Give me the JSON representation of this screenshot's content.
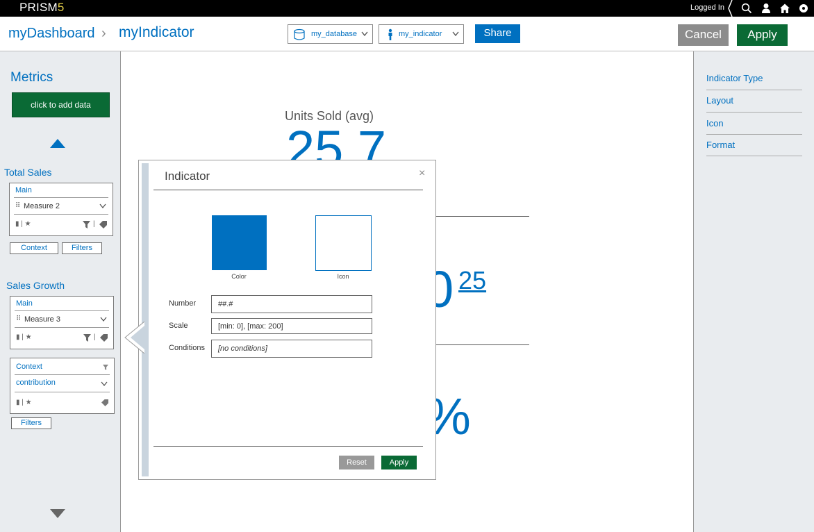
{
  "topbar": {
    "brand_text": "PRISM",
    "brand_num": "5",
    "logged_in": "Logged In",
    "icons": [
      "search-icon",
      "user-icon",
      "home-icon",
      "settings-icon"
    ]
  },
  "header": {
    "breadcrumb_home": "myDashboard",
    "breadcrumb_sep": "›",
    "breadcrumb_current": "myIndicator",
    "database_select": "my_database",
    "indicator_select": "my_indicator",
    "share_label": "Share",
    "cancel_label": "Cancel",
    "apply_label": "Apply"
  },
  "sidebar_left": {
    "title": "Metrics",
    "add_data_label": "click to add data",
    "sections": [
      {
        "title": "Total Sales",
        "card_title": "Main",
        "measure": "Measure 2",
        "buttons": [
          "Context",
          "Filters"
        ]
      },
      {
        "title": "Sales Growth",
        "card_title": "Main",
        "measure": "Measure 3",
        "context_card_title": "Context",
        "context_value": "contribution",
        "buttons": [
          "Filters"
        ]
      }
    ]
  },
  "main": {
    "metric_label": "Units Sold (avg)",
    "big_value_top": "25.7",
    "big_value_mid": "0",
    "sup_value": "25",
    "big_value_bottom": "%"
  },
  "dialog": {
    "title": "Indicator",
    "close_label": "×",
    "color_caption": "Color",
    "icon_caption": "Icon",
    "swatch_color": "#0070c0",
    "fields": [
      {
        "label": "Number",
        "value": "##.#"
      },
      {
        "label": "Scale",
        "value": "[min: 0], [max: 200]"
      },
      {
        "label": "Conditions",
        "value": "[no conditions]"
      }
    ],
    "reset_label": "Reset",
    "apply_label": "Apply"
  },
  "sidebar_right": {
    "items": [
      "Indicator Type",
      "Layout",
      "Icon",
      "Format"
    ]
  },
  "colors": {
    "accent_blue": "#0070c0",
    "apply_green": "#0a6a35",
    "cancel_gray": "#8c8c8c",
    "panel_bg": "#e9ecef"
  }
}
